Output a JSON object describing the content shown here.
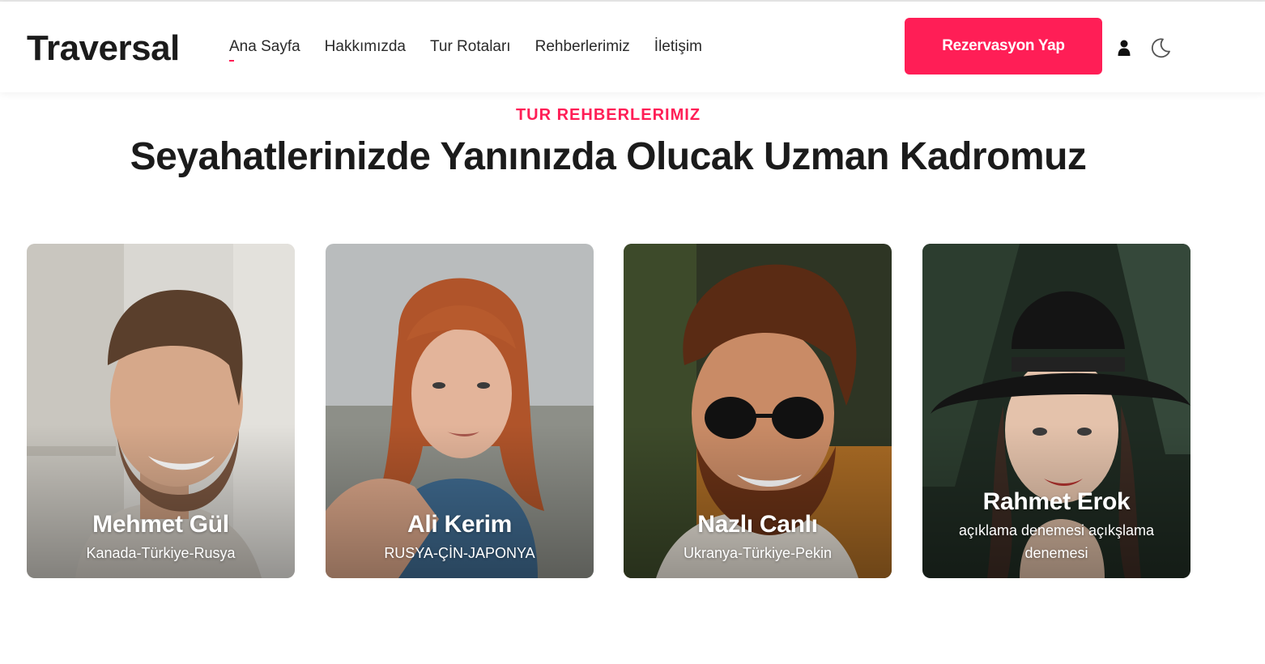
{
  "header": {
    "brand": "Traversal",
    "nav": [
      "Ana Sayfa",
      "Hakkımızda",
      "Tur Rotaları",
      "Rehberlerimiz",
      "İletişim"
    ],
    "active_nav": "Ana Sayfa",
    "cta_label": "Rezervasyon Yap",
    "icons": [
      "user-icon",
      "moon-icon"
    ]
  },
  "section": {
    "eyebrow": "TUR REHBERLERIMIZ",
    "title": "Seyahatlerinizde Yanınızda Olucak Uzman Kadromuz"
  },
  "guides": [
    {
      "name": "Mehmet Gül",
      "route": "Kanada-Türkiye-Rusya"
    },
    {
      "name": "Ali Kerim",
      "route": "RUSYA-ÇİN-JAPONYA"
    },
    {
      "name": "Nazlı Canlı",
      "route": "Ukranya-Türkiye-Pekin"
    },
    {
      "name": "Rahmet Erok",
      "route": "açıklama denemesi açıkşlama denemesi"
    }
  ],
  "colors": {
    "accent": "#ff1e56",
    "text": "#1b1b1b",
    "background": "#ffffff"
  }
}
